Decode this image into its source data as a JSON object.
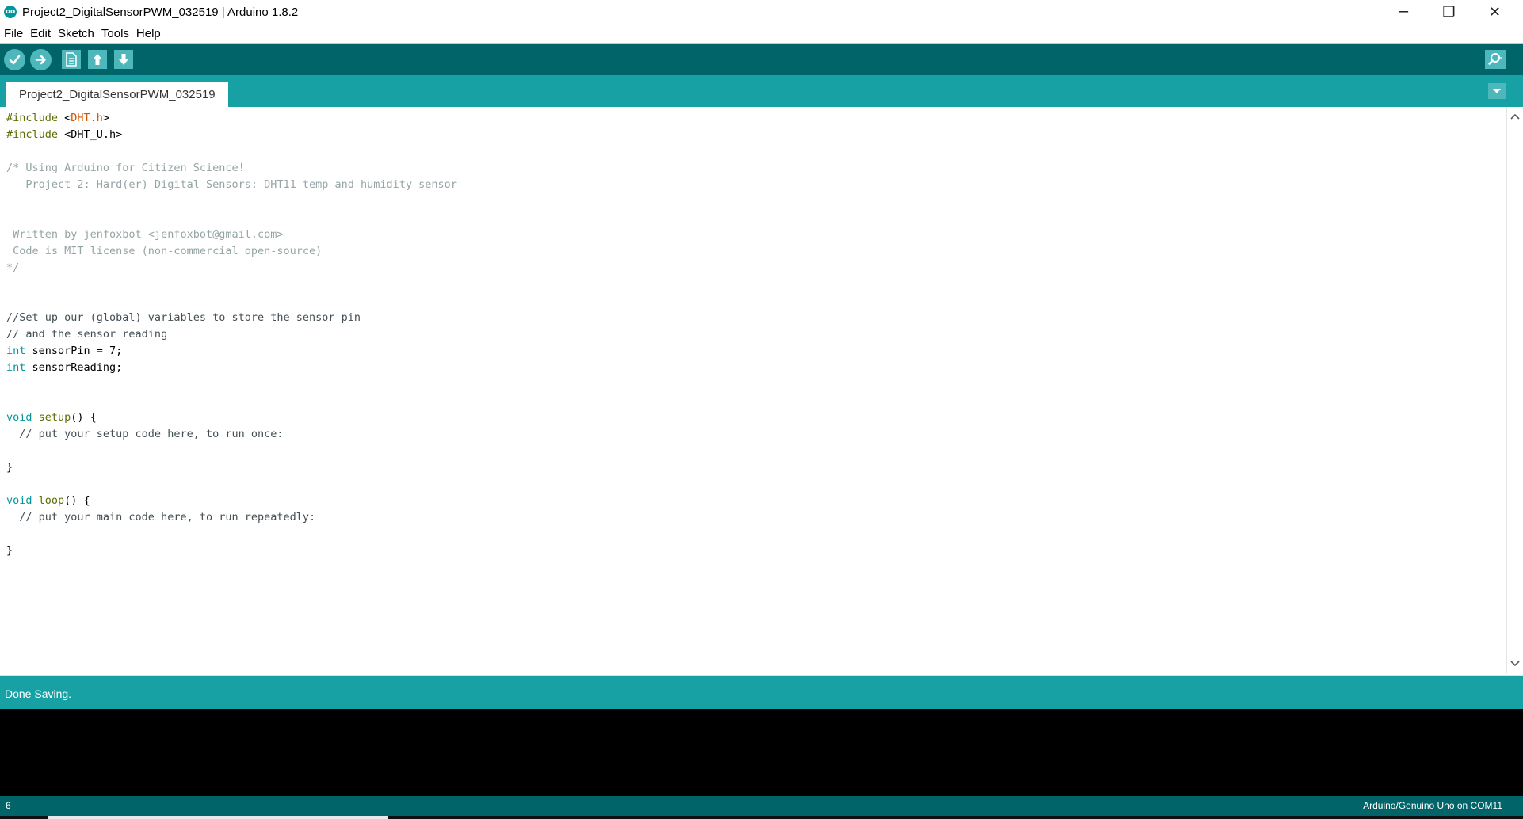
{
  "window": {
    "title": "Project2_DigitalSensorPWM_032519 | Arduino 1.8.2",
    "app_icon_text": "oo",
    "controls": {
      "minimize": "─",
      "restore": "❐",
      "close": "✕"
    }
  },
  "menu": {
    "items": [
      "File",
      "Edit",
      "Sketch",
      "Tools",
      "Help"
    ]
  },
  "toolbar": {
    "buttons": [
      {
        "name": "verify",
        "icon": "check-icon"
      },
      {
        "name": "upload",
        "icon": "arrow-right-icon"
      },
      {
        "name": "new",
        "icon": "new-file-icon"
      },
      {
        "name": "open",
        "icon": "arrow-up-icon"
      },
      {
        "name": "save",
        "icon": "arrow-down-icon"
      }
    ],
    "serial_monitor_icon": "magnifier-icon"
  },
  "tabs": {
    "active": "Project2_DigitalSensorPWM_032519",
    "menu_icon": "chevron-down-icon"
  },
  "editor": {
    "lines": [
      [
        {
          "t": "#include",
          "c": "kw-pre"
        },
        {
          "t": " <"
        },
        {
          "t": "DHT.h",
          "c": "hdr"
        },
        {
          "t": ">"
        }
      ],
      [
        {
          "t": "#include",
          "c": "kw-pre"
        },
        {
          "t": " <DHT_U.h>"
        }
      ],
      [],
      [
        {
          "t": "/* Using Arduino for Citizen Science!",
          "c": "cm"
        }
      ],
      [
        {
          "t": "   Project 2: Hard(er) Digital Sensors: DHT11 temp and humidity sensor",
          "c": "cm"
        }
      ],
      [],
      [],
      [
        {
          "t": " Written by jenfoxbot <jenfoxbot@gmail.com>",
          "c": "cm"
        }
      ],
      [
        {
          "t": " Code is MIT license (non-commercial open-source)",
          "c": "cm"
        }
      ],
      [
        {
          "t": "*/",
          "c": "cm"
        }
      ],
      [],
      [],
      [
        {
          "t": "//Set up our (global) variables to store the sensor pin",
          "c": "cm-dark"
        }
      ],
      [
        {
          "t": "// and the sensor reading",
          "c": "cm-dark"
        }
      ],
      [
        {
          "t": "int",
          "c": "kw-type"
        },
        {
          "t": " sensorPin = 7;"
        }
      ],
      [
        {
          "t": "int",
          "c": "kw-type"
        },
        {
          "t": " sensorReading;"
        }
      ],
      [],
      [],
      [
        {
          "t": "void",
          "c": "kw-type"
        },
        {
          "t": " "
        },
        {
          "t": "setup",
          "c": "kw-func"
        },
        {
          "t": "() {"
        }
      ],
      [
        {
          "t": "  // put your setup code here, to run once:",
          "c": "cm-dark"
        }
      ],
      [],
      [
        {
          "t": "}"
        }
      ],
      [],
      [
        {
          "t": "void",
          "c": "kw-type"
        },
        {
          "t": " "
        },
        {
          "t": "loop",
          "c": "kw-func"
        },
        {
          "t": "() {"
        }
      ],
      [
        {
          "t": "  // put your main code here, to run repeatedly:",
          "c": "cm-dark"
        }
      ],
      [],
      [
        {
          "t": "}"
        }
      ]
    ]
  },
  "status": {
    "message": "Done Saving."
  },
  "footer": {
    "line_number": "6",
    "board": "Arduino/Genuino Uno on COM11"
  },
  "colors": {
    "toolbar": "#006468",
    "tabbar": "#17a1a5",
    "button": "#4db7bb",
    "console": "#000000"
  }
}
